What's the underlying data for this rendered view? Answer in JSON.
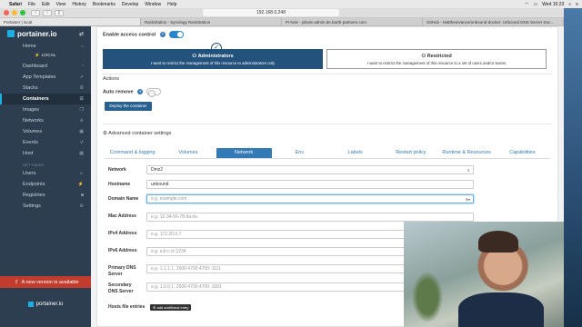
{
  "menubar": {
    "app": "Safari",
    "items": [
      "File",
      "Edit",
      "View",
      "History",
      "Bookmarks",
      "Develop",
      "Window",
      "Help"
    ],
    "clock": "Wed 15:23"
  },
  "browser": {
    "url": "192.168.0.248",
    "tabs": [
      "Portainer | local",
      "RackStation - Synology RackStation",
      "Pi-hole - pihole.admin.de.barth-partners.com",
      "GitHub - MatthewVance/unbound-docker: Unbound DNS Server Doc..."
    ]
  },
  "sidebar": {
    "logo": "portainer.io",
    "home": "Home",
    "endpoint": "LOCAL",
    "items": [
      {
        "label": "Dashboard",
        "icon": "dashboard-icon"
      },
      {
        "label": "App Templates",
        "icon": "rocket-icon"
      },
      {
        "label": "Stacks",
        "icon": "stacks-icon"
      },
      {
        "label": "Containers",
        "icon": "server-icon",
        "active": true
      },
      {
        "label": "Images",
        "icon": "clone-icon"
      },
      {
        "label": "Networks",
        "icon": "sitemap-icon"
      },
      {
        "label": "Volumes",
        "icon": "cubes-icon"
      },
      {
        "label": "Events",
        "icon": "history-icon"
      },
      {
        "label": "Host",
        "icon": "th-icon"
      }
    ],
    "settings_title": "SETTINGS",
    "settings": [
      {
        "label": "Users",
        "icon": "users-icon"
      },
      {
        "label": "Endpoints",
        "icon": "plug-icon"
      },
      {
        "label": "Registries",
        "icon": "database-icon"
      },
      {
        "label": "Settings",
        "icon": "cogs-icon"
      }
    ],
    "update_notice": "A new version is available",
    "footer_logo": "portainer.io"
  },
  "form": {
    "access_control_label": "Enable access control",
    "admin_title": "Administrators",
    "admin_desc": "I want to restrict the management of this resource to administrators only",
    "restricted_title": "Restricted",
    "restricted_desc": "I want to restrict the management of this resource to a set of users and/or teams",
    "actions_title": "Actions",
    "auto_remove_label": "Auto remove",
    "deploy_button": "Deploy the container",
    "advanced_title": "Advanced container settings",
    "tabs": [
      "Command & logging",
      "Volumes",
      "Network",
      "Env",
      "Labels",
      "Restart policy",
      "Runtime & Resources",
      "Capabilities"
    ],
    "active_tab": "Network",
    "fields": {
      "network_label": "Network",
      "network_value": "Dmz2",
      "hostname_label": "Hostname",
      "hostname_value": "unbound",
      "domain_label": "Domain Name",
      "domain_placeholder": "e.g. example.com",
      "mac_label": "Mac Address",
      "mac_placeholder": "e.g. 12-34-56-78-9a-bc",
      "ipv4_label": "IPv4 Address",
      "ipv4_placeholder": "e.g. 172.20.0.7",
      "ipv6_label": "IPv6 Address",
      "ipv6_placeholder": "e.g. a:b:c:d::1234",
      "dns1_label": "Primary DNS Server",
      "dns1_placeholder": "e.g. 1.1.1.1, 2606:4700:4700::1111",
      "dns2_label": "Secondary DNS Server",
      "dns2_placeholder": "e.g. 1.0.0.1, 2606:4700:4700::1001",
      "hosts_label": "Hosts file entries",
      "hosts_button": "add additional entry"
    }
  }
}
